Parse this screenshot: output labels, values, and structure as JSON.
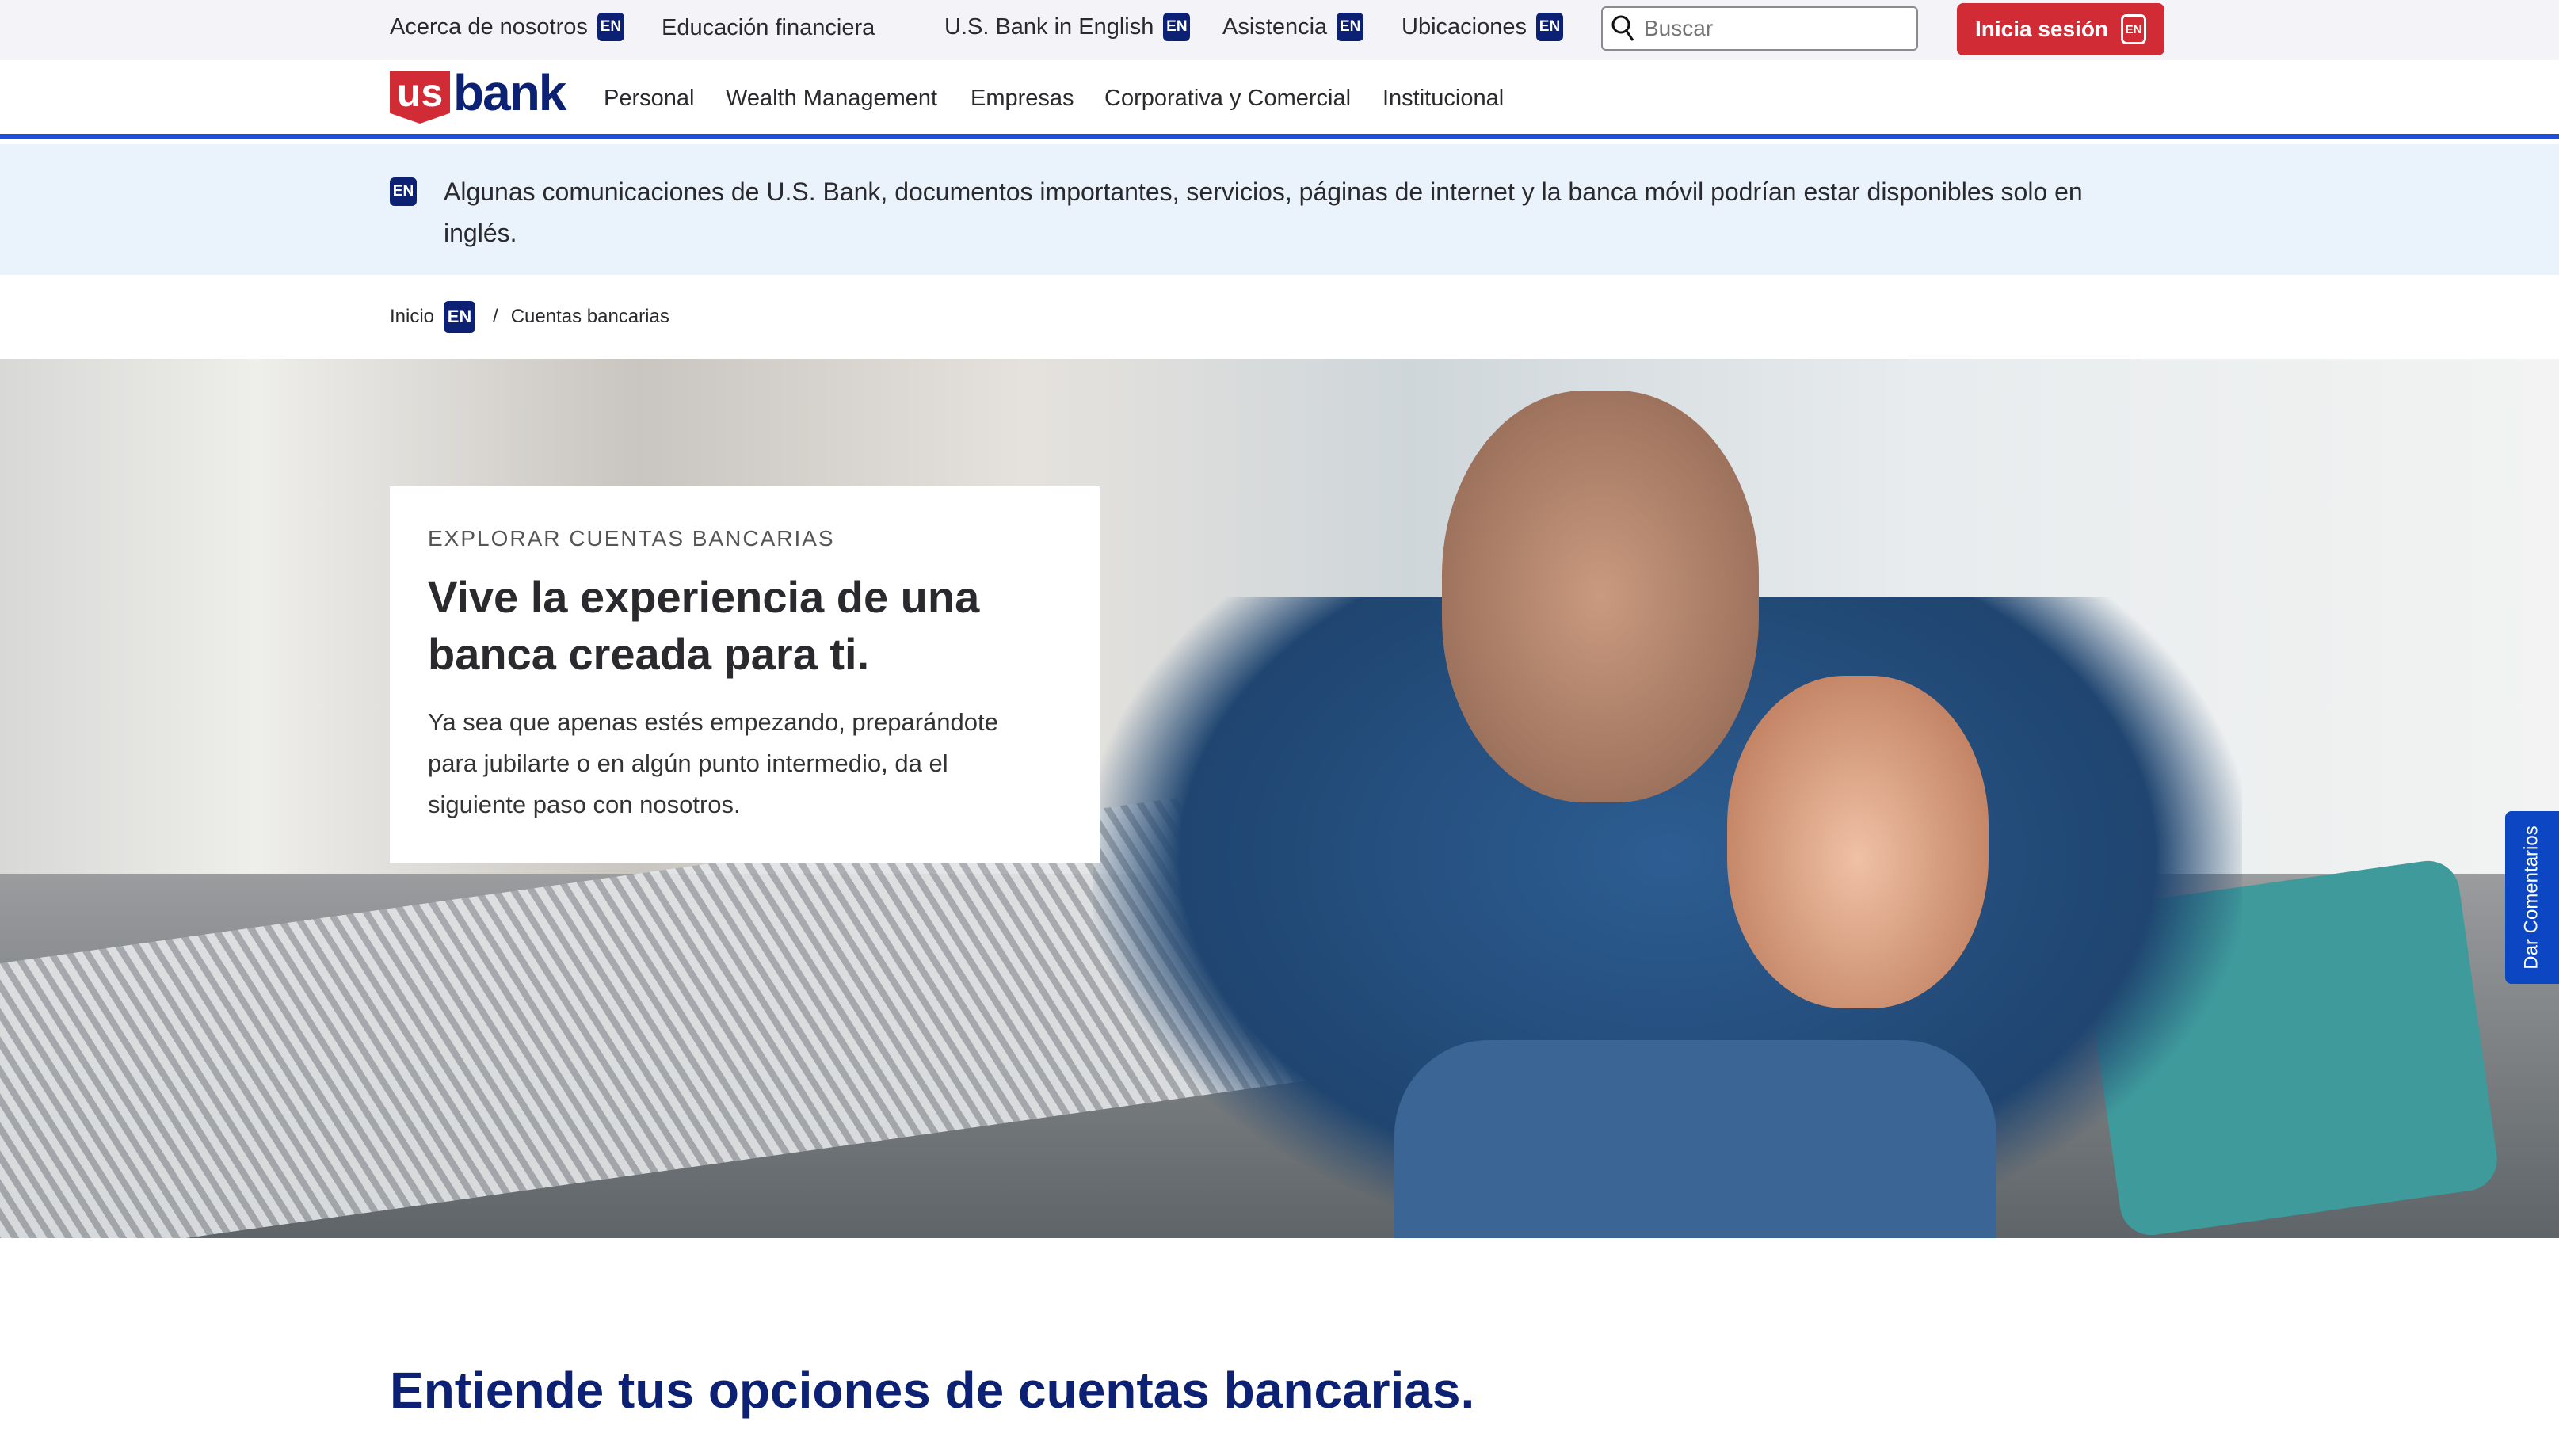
{
  "topbar": {
    "items": [
      {
        "label": "Acerca de nosotros",
        "badge": "EN"
      },
      {
        "label": "Educación financiera"
      },
      {
        "label": "U.S. Bank in English",
        "badge": "EN"
      },
      {
        "label": "Asistencia",
        "badge": "EN"
      },
      {
        "label": "Ubicaciones",
        "badge": "EN"
      }
    ],
    "search_placeholder": "Buscar",
    "login_label": "Inicia sesión",
    "login_badge": "EN"
  },
  "logo": {
    "us": "us",
    "bank": "bank"
  },
  "nav": {
    "items": [
      "Personal",
      "Wealth Management",
      "Empresas",
      "Corporativa y Comercial",
      "Institucional"
    ]
  },
  "banner": {
    "badge": "EN",
    "text": "Algunas comunicaciones de U.S. Bank, documentos importantes, servicios, páginas de internet y la banca móvil podrían estar disponibles solo en inglés."
  },
  "breadcrumb": {
    "home": "Inicio",
    "home_badge": "EN",
    "separator": "/",
    "current": "Cuentas bancarias"
  },
  "hero": {
    "eyebrow": "EXPLORAR CUENTAS BANCARIAS",
    "title": "Vive la experiencia de una banca creada para ti.",
    "body": "Ya sea que apenas estés empezando, preparándote para jubilarte o en algún punto intermedio, da el siguiente paso con nosotros."
  },
  "feedback": "Dar Comentarios",
  "section_title": "Entiende tus opciones de cuentas bancarias.",
  "colors": {
    "brand_red": "#d12b35",
    "brand_navy": "#0c2074",
    "accent_blue": "#1f50d4"
  }
}
